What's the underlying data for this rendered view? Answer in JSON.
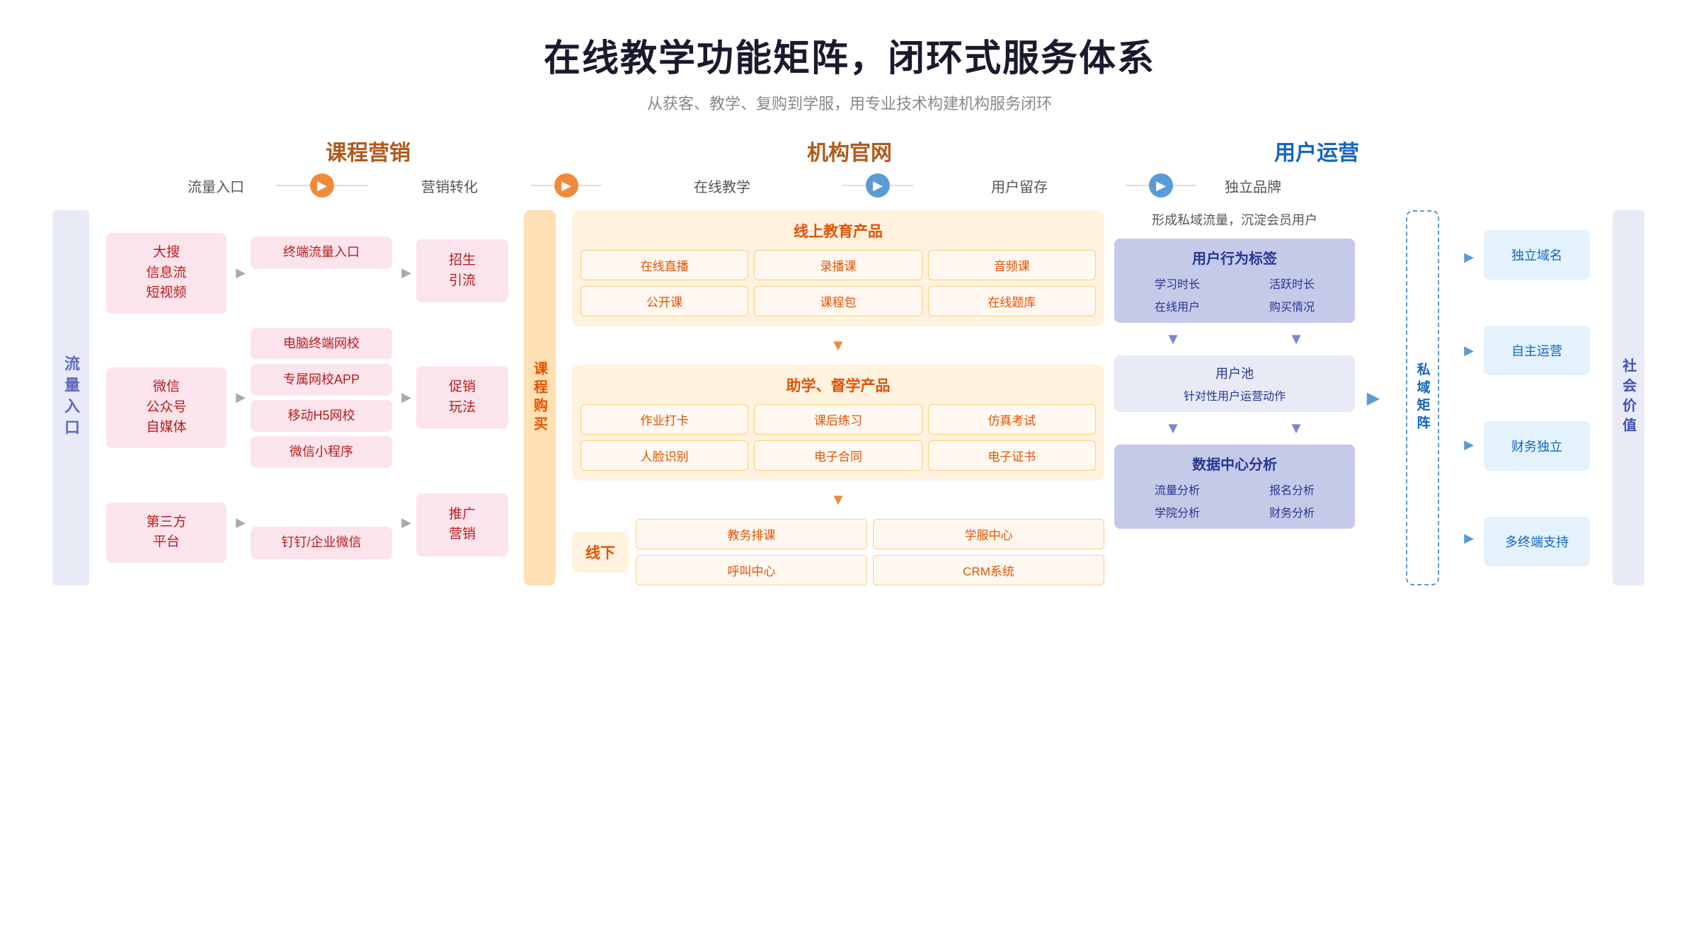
{
  "header": {
    "title": "在线教学功能矩阵，闭环式服务体系",
    "subtitle": "从获客、教学、复购到学服，用专业技术构建机构服务闭环"
  },
  "categories": {
    "marketing": "课程营销",
    "official_site": "机构官网",
    "user_ops": "用户运营"
  },
  "flow_labels": {
    "traffic_entry": "流量入口",
    "marketing_conversion": "营销转化",
    "online_teaching": "在线教学",
    "user_retention": "用户留存",
    "independent_brand": "独立品牌"
  },
  "left_label": "流量入口",
  "traffic_sources": [
    {
      "text": "大搜\n信息流\n短视频"
    },
    {
      "text": "微信\n公众号\n自媒体"
    },
    {
      "text": "第三方\n平台"
    }
  ],
  "channels": {
    "group1": [
      "终端流量入口"
    ],
    "group2": [
      "电脑终端网校",
      "专属网校APP",
      "移动H5网校",
      "微信小程序"
    ],
    "group3": [
      "钉钉/企业微信"
    ]
  },
  "conversions": [
    {
      "text": "招生\n引流"
    },
    {
      "text": "促销\n玩法"
    },
    {
      "text": "推广\n营销"
    }
  ],
  "course_purchase_label": "课程购买",
  "online_edu": {
    "online_products_title": "线上教育产品",
    "online_products": [
      "在线直播",
      "录播课",
      "音频课",
      "公开课",
      "课程包",
      "在线题库"
    ],
    "supervision_title": "助学、督学产品",
    "supervision_items": [
      "作业打卡",
      "课后练习",
      "仿真考试",
      "人脸识别",
      "电子合同",
      "电子证书"
    ],
    "offline_label": "线下",
    "offline_items": [
      "教务排课",
      "学服中心",
      "呼叫中心",
      "CRM系统"
    ]
  },
  "user_retention": {
    "top_text": "形成私域流量，沉淀会员用户",
    "behavior_tag_title": "用户行为标签",
    "behavior_items": [
      "学习时长",
      "活跃时长",
      "在线用户",
      "购买情况"
    ],
    "user_pool_title": "用户池",
    "user_pool_sub": "针对性用户运营动作",
    "data_center_title": "数据中心分析",
    "data_items": [
      "流量分析",
      "报名分析",
      "学院分析",
      "财务分析"
    ]
  },
  "private_domain_label": "私域矩阵",
  "brand_items": [
    "独立域名",
    "自主运营",
    "财务独立",
    "多终端支持"
  ],
  "social_value_label": "社会价值"
}
